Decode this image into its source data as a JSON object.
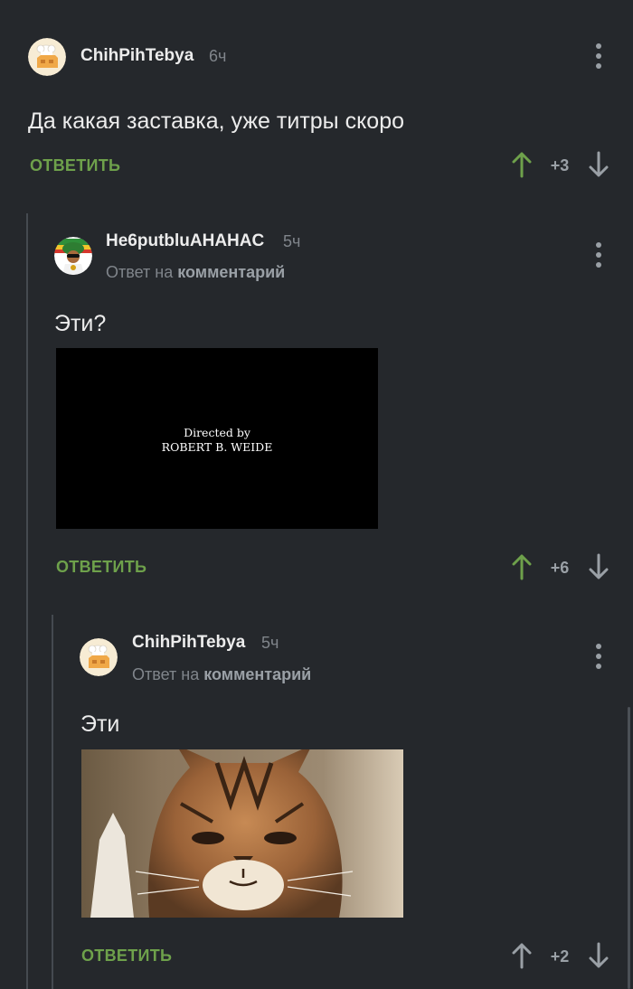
{
  "comments": [
    {
      "author": "ChihPihTebya",
      "time": "6ч",
      "text": "Да какая заставка, уже титры скоро",
      "reply_label": "ОТВЕТИТЬ",
      "rating": "+3"
    },
    {
      "author": "He6putbluAHAHAC",
      "time": "5ч",
      "reply_to_prefix": "Ответ на",
      "reply_to_link": "комментарий",
      "text": "Эти?",
      "image": {
        "line1": "Directed by",
        "line2": "ROBERT B. WEIDE"
      },
      "reply_label": "ОТВЕТИТЬ",
      "rating": "+6"
    },
    {
      "author": "ChihPihTebya",
      "time": "5ч",
      "reply_to_prefix": "Ответ на",
      "reply_to_link": "комментарий",
      "text": "Эти",
      "reply_label": "ОТВЕТИТЬ",
      "rating": "+2"
    }
  ],
  "colors": {
    "background": "#25282c",
    "accent_green": "#6ea14b",
    "upvote_active": "#6ea14b",
    "muted": "#80858b"
  }
}
